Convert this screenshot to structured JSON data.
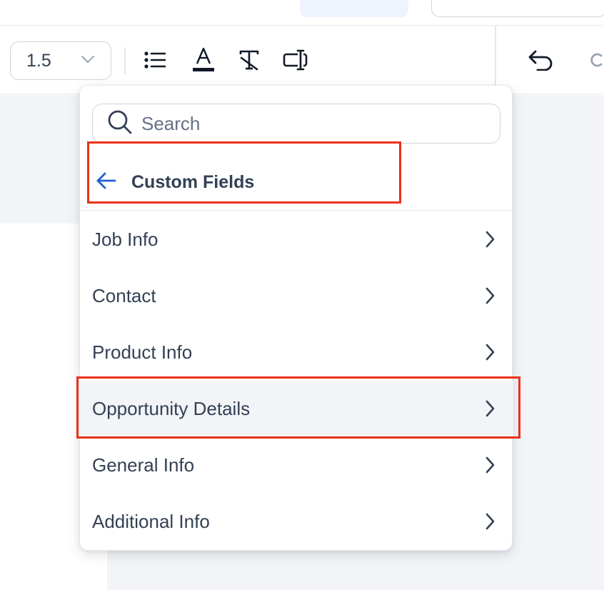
{
  "toolbar": {
    "line_height": {
      "value": "1.5"
    },
    "icons": [
      "bulleted-list-icon",
      "text-color-icon",
      "clear-formatting-icon",
      "text-field-icon",
      "undo-icon"
    ]
  },
  "dropdown": {
    "search": {
      "placeholder": "Search",
      "value": ""
    },
    "header": {
      "title": "Custom Fields"
    },
    "items": [
      {
        "label": "Job Info"
      },
      {
        "label": "Contact"
      },
      {
        "label": "Product Info"
      },
      {
        "label": "Opportunity Details",
        "active": true
      },
      {
        "label": "General Info"
      },
      {
        "label": "Additional Info"
      }
    ]
  },
  "colors": {
    "accent_blue": "#1f5fd6",
    "text": "#344054",
    "highlight_red": "#e8321c",
    "active_row": "#f2f4f8"
  }
}
